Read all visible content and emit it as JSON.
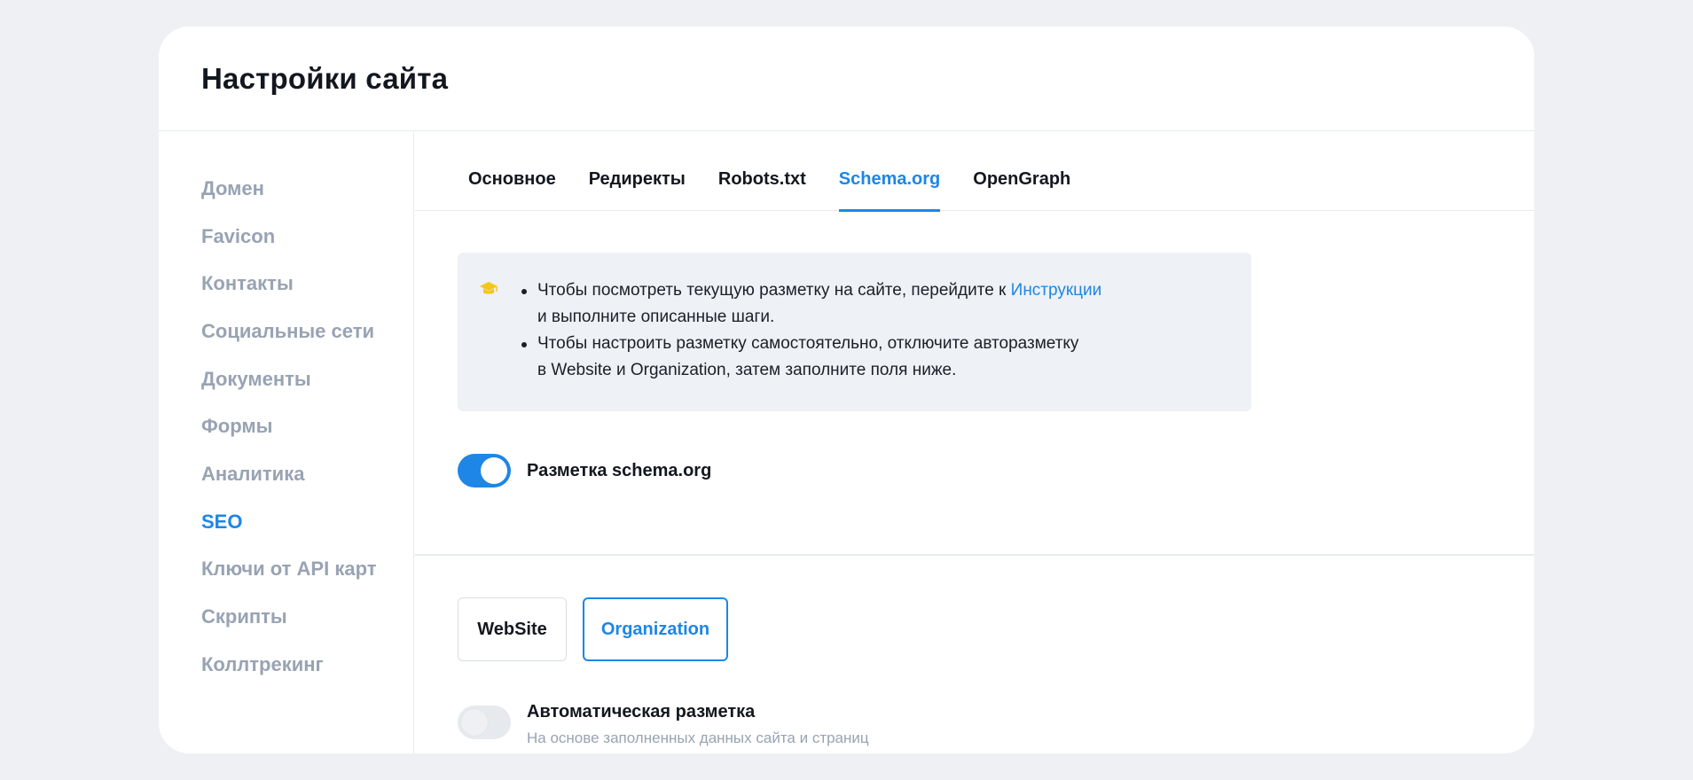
{
  "header": {
    "title": "Настройки сайта"
  },
  "sidebar": {
    "items": [
      {
        "label": "Домен"
      },
      {
        "label": "Favicon"
      },
      {
        "label": "Контакты"
      },
      {
        "label": "Социальные сети"
      },
      {
        "label": "Документы"
      },
      {
        "label": "Формы"
      },
      {
        "label": "Аналитика"
      },
      {
        "label": "SEO",
        "active": true
      },
      {
        "label": "Ключи от API карт"
      },
      {
        "label": "Скрипты"
      },
      {
        "label": "Коллтрекинг"
      }
    ]
  },
  "tabs": [
    {
      "label": "Основное"
    },
    {
      "label": "Редиректы"
    },
    {
      "label": "Robots.txt"
    },
    {
      "label": "Schema.org",
      "active": true
    },
    {
      "label": "OpenGraph"
    }
  ],
  "info": {
    "icon": "graduation-cap-icon",
    "items": [
      {
        "text_before": "Чтобы посмотреть текущую разметку на сайте, перейдите к",
        "link": "Инструкции",
        "text_after": "и выполните описанные шаги."
      },
      {
        "line1": "Чтобы настроить разметку самостоятельно, отключите авторазметку",
        "line2": "в Website и Organization, затем заполните поля ниже."
      }
    ]
  },
  "schema_toggle": {
    "label": "Разметка schema.org",
    "enabled": true
  },
  "type_selector": {
    "options": [
      {
        "label": "WebSite"
      },
      {
        "label": "Organization",
        "selected": true
      }
    ]
  },
  "auto_markup": {
    "title": "Автоматическая разметка",
    "subtitle": "На основе заполненных данных сайта и страниц",
    "enabled": false
  },
  "colors": {
    "accent": "#1d86e6",
    "muted_text": "#98a3b3",
    "page_bg": "#eef0f4",
    "info_bg": "#eef1f5",
    "icon_yellow": "#f5c518"
  }
}
